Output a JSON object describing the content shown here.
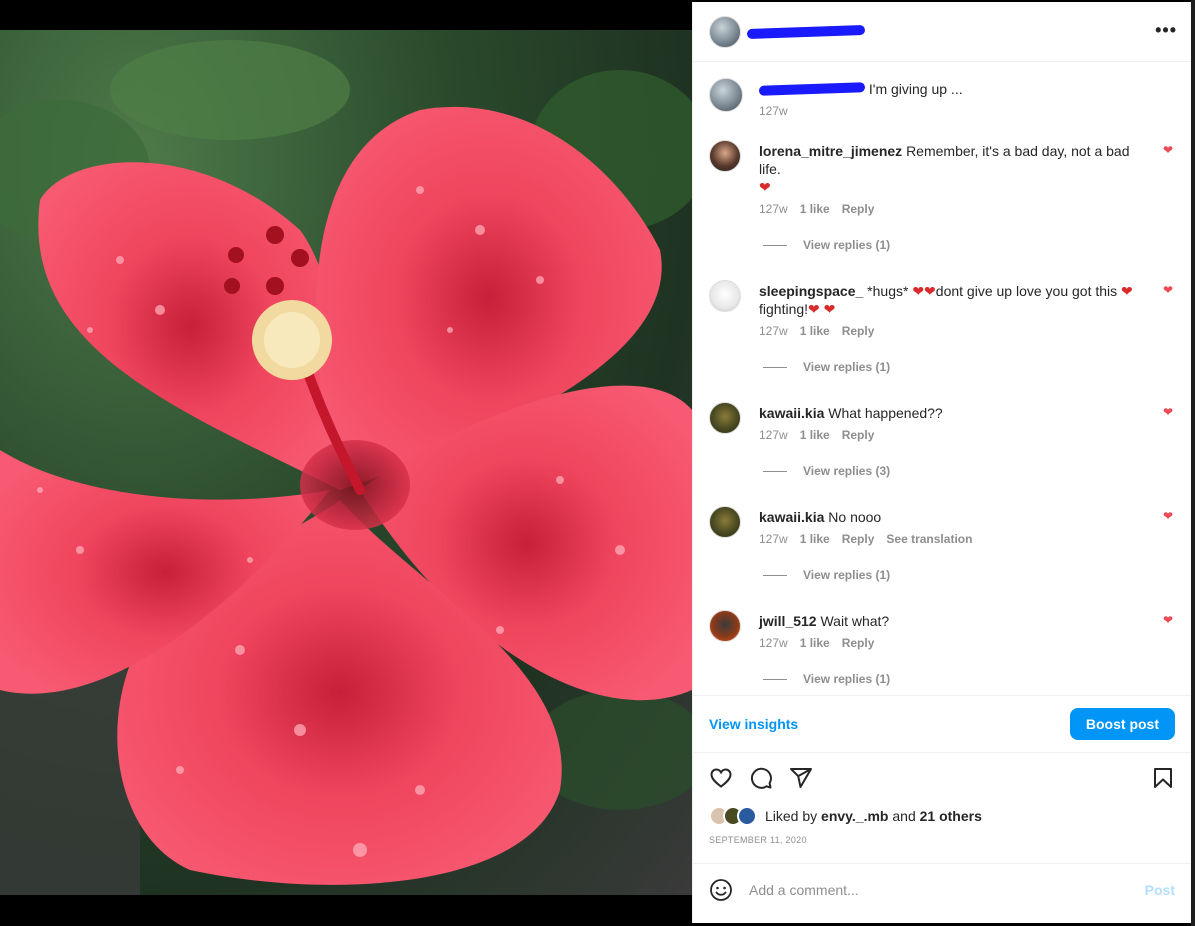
{
  "post": {
    "caption_text": "I'm giving up ...",
    "caption_time": "127w"
  },
  "header": {
    "more_icon": "more-horizontal-icon",
    "more_label": "•••"
  },
  "comments": [
    {
      "username": "lorena_mitre_jimenez",
      "text": "Remember, it's a bad day, not a bad life.",
      "emoji_after": "❤",
      "time": "127w",
      "likes": "1 like",
      "reply": "Reply",
      "view_replies": "View replies (1)"
    },
    {
      "username": "sleepingspace_",
      "text_part1": "*hugs*",
      "emoji1": "❤❤",
      "text_part2": "dont give up love you got this",
      "emoji2": "❤",
      "text_part3": "fighting!",
      "emoji3": "❤ ❤",
      "time": "127w",
      "likes": "1 like",
      "reply": "Reply",
      "view_replies": "View replies (1)"
    },
    {
      "username": "kawaii.kia",
      "text": "What happened??",
      "time": "127w",
      "likes": "1 like",
      "reply": "Reply",
      "view_replies": "View replies (3)"
    },
    {
      "username": "kawaii.kia",
      "text": "No nooo",
      "time": "127w",
      "likes": "1 like",
      "reply": "Reply",
      "see_translation": "See translation",
      "view_replies": "View replies (1)"
    },
    {
      "username": "jwill_512",
      "text": "Wait what?",
      "time": "127w",
      "likes": "1 like",
      "reply": "Reply",
      "view_replies": "View replies (1)"
    }
  ],
  "insights": {
    "view_insights": "View insights",
    "boost_post": "Boost post"
  },
  "likes": {
    "prefix": "Liked by",
    "user": "envy._.mb",
    "middle": "and",
    "others": "21 others"
  },
  "date": "SEPTEMBER 11, 2020",
  "add_comment": {
    "placeholder": "Add a comment...",
    "post": "Post"
  },
  "colors": {
    "accent": "#0095f6",
    "like_red": "#ed4956",
    "muted": "#8e8e8e",
    "redaction": "#1a1aff"
  }
}
